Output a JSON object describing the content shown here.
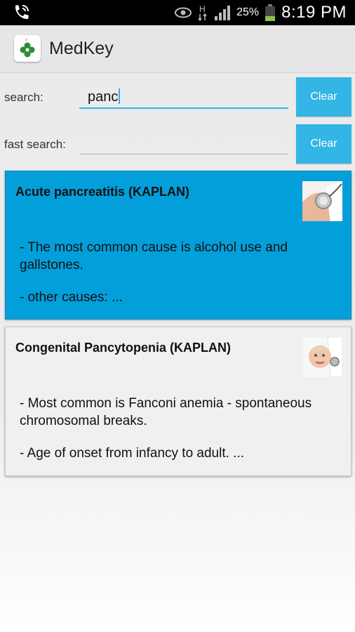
{
  "status_bar": {
    "battery": "25%",
    "time": "8:19 PM",
    "icons": [
      "phone-call-icon",
      "eye-icon",
      "hspa-data-icon",
      "signal-icon",
      "battery-icon"
    ]
  },
  "app": {
    "title": "MedKey",
    "icon": "medkey-logo-icon"
  },
  "search": {
    "label": "search:",
    "value": "panc",
    "clear_label": "Clear"
  },
  "fast_search": {
    "label": "fast search:",
    "value": "",
    "clear_label": "Clear"
  },
  "results": [
    {
      "title": "Acute pancreatitis (KAPLAN)",
      "lines": [
        "- The most common cause is alcohol use and gallstones.",
        "- other causes: ..."
      ],
      "thumb": "stethoscope-image",
      "selected": true
    },
    {
      "title": "Congenital Pancytopenia (KAPLAN)",
      "lines": [
        "- Most common is Fanconi anemia - spontaneous chromosomal breaks.",
        "- Age of onset from infancy to adult. ..."
      ],
      "thumb": "baby-doctor-image",
      "selected": false
    }
  ],
  "colors": {
    "accent": "#33b5e5",
    "selected_card": "#039fda",
    "card": "#eff0f0"
  }
}
